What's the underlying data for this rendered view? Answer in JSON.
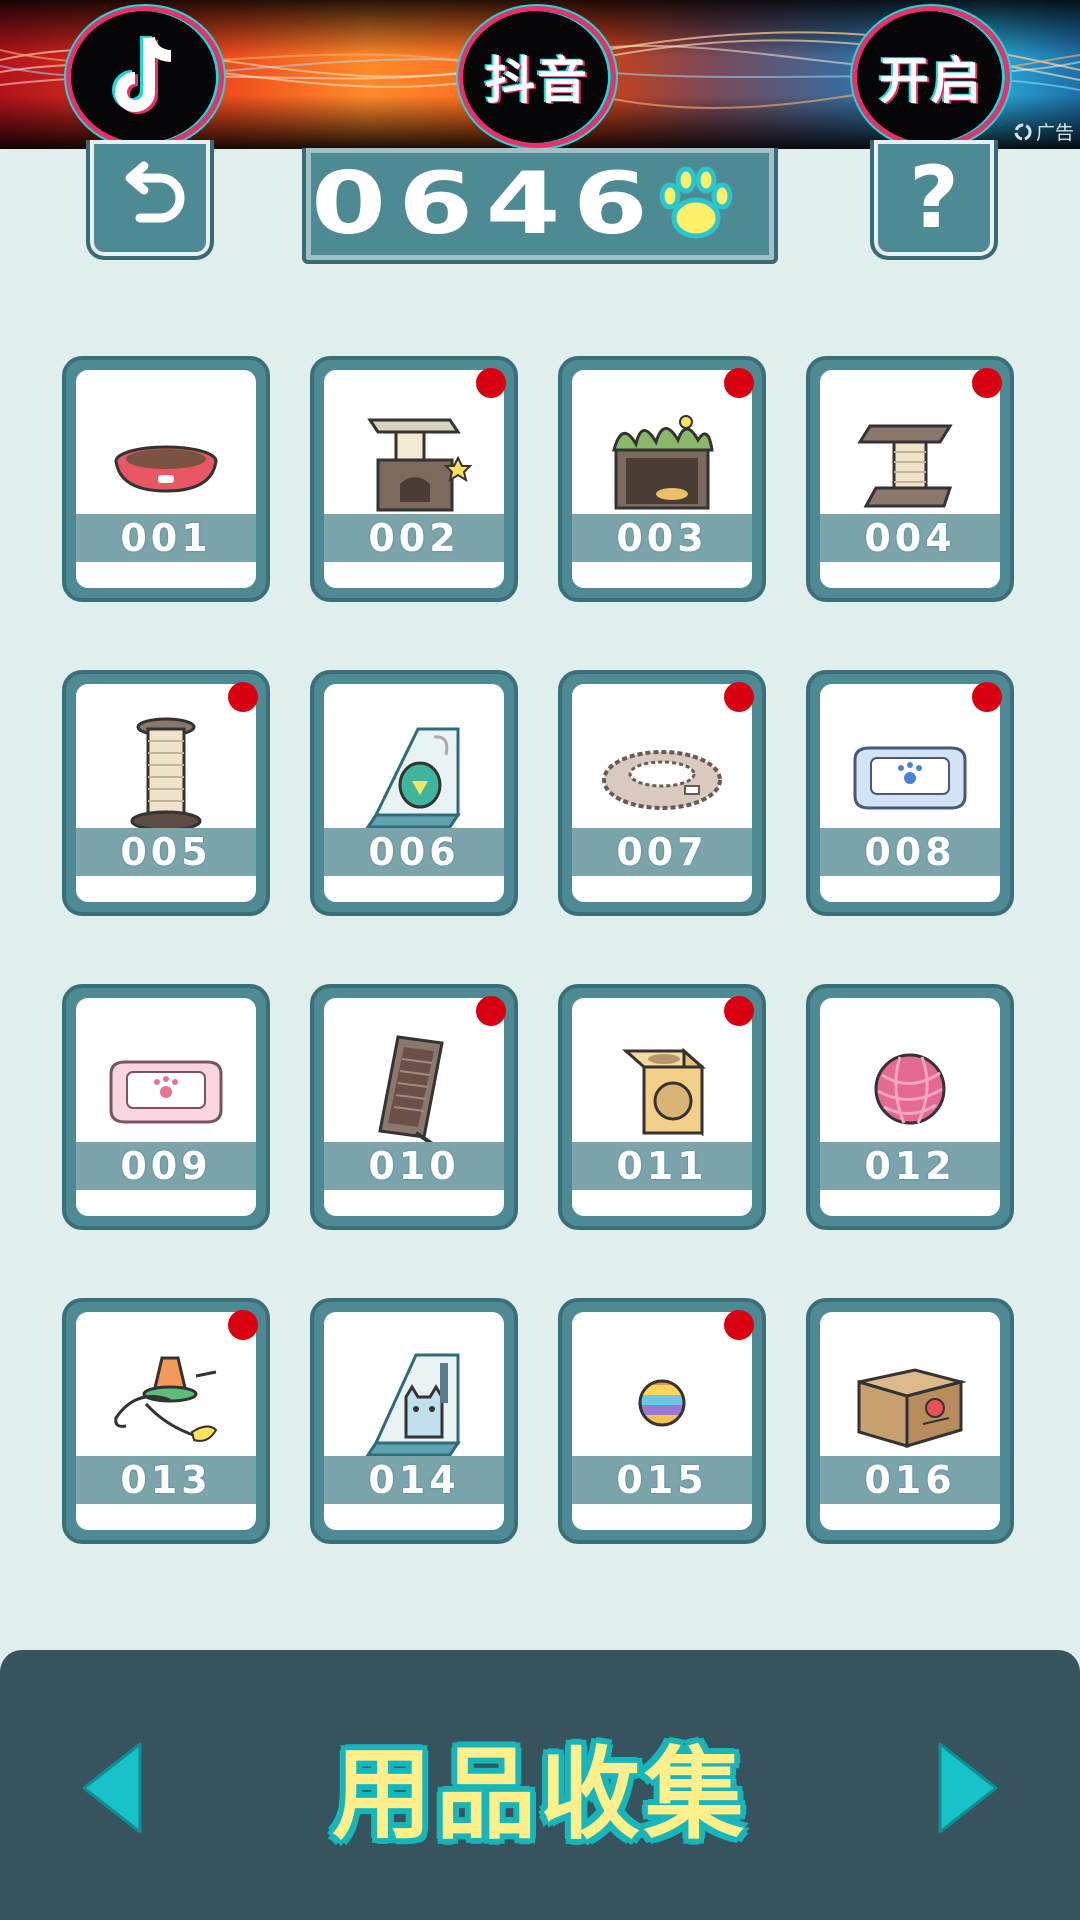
{
  "ad": {
    "buttons": [
      "抖音",
      "开启"
    ],
    "tag": "广告"
  },
  "top_bar": {
    "counter": "0646",
    "help_label": "?"
  },
  "items": [
    {
      "id": "001",
      "new": false,
      "icon": "food-bowl-icon"
    },
    {
      "id": "002",
      "new": true,
      "icon": "cat-house-icon"
    },
    {
      "id": "003",
      "new": true,
      "icon": "leafy-box-icon"
    },
    {
      "id": "004",
      "new": true,
      "icon": "scratch-post-icon"
    },
    {
      "id": "005",
      "new": true,
      "icon": "scratch-pole-icon"
    },
    {
      "id": "006",
      "new": false,
      "icon": "toy-box-icon"
    },
    {
      "id": "007",
      "new": true,
      "icon": "fluffy-ring-icon"
    },
    {
      "id": "008",
      "new": true,
      "icon": "blue-bed-icon"
    },
    {
      "id": "009",
      "new": false,
      "icon": "pink-bed-icon"
    },
    {
      "id": "010",
      "new": true,
      "icon": "scratch-board-icon"
    },
    {
      "id": "011",
      "new": true,
      "icon": "cube-house-icon"
    },
    {
      "id": "012",
      "new": false,
      "icon": "yarn-ball-icon"
    },
    {
      "id": "013",
      "new": true,
      "icon": "teaser-wand-icon"
    },
    {
      "id": "014",
      "new": false,
      "icon": "cat-figure-box-icon"
    },
    {
      "id": "015",
      "new": true,
      "icon": "rainbow-ball-icon"
    },
    {
      "id": "016",
      "new": false,
      "icon": "cardboard-box-icon"
    }
  ],
  "footer": {
    "title": "用品收集"
  },
  "colors": {
    "background": "#e1eeee",
    "card": "#4e8a94",
    "footer": "#37535d",
    "arrow": "#17c2c8",
    "new_dot": "#d80010",
    "title": "#fff08c"
  }
}
